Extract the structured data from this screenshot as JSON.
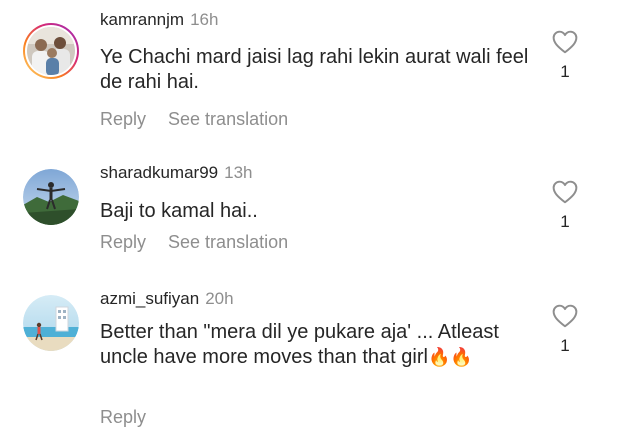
{
  "comments": [
    {
      "username": "kamrannjm",
      "time": "16h",
      "text": "Ye Chachi mard jaisi lag rahi lekin aurat wali feel de rahi hai.",
      "reply_label": "Reply",
      "translate_label": "See translation",
      "likes": "1",
      "avatar_icon": "avatar-photo-people-icon",
      "avatar_ring": "#d62976"
    },
    {
      "username": "sharadkumar99",
      "time": "13h",
      "text": "Baji to kamal hai..",
      "reply_label": "Reply",
      "translate_label": "See translation",
      "likes": "1",
      "avatar_icon": "avatar-photo-landscape-icon"
    },
    {
      "username": "azmi_sufiyan",
      "time": "20h",
      "text": "Better than \"mera dil ye pukare aja' ... Atleast uncle have more moves than that girl",
      "emoji": "🔥🔥",
      "reply_label": "Reply",
      "likes": "1",
      "avatar_icon": "avatar-photo-beach-icon"
    }
  ],
  "colors": {
    "text": "#262626",
    "secondary": "#8e8e8e",
    "background": "#ffffff"
  }
}
